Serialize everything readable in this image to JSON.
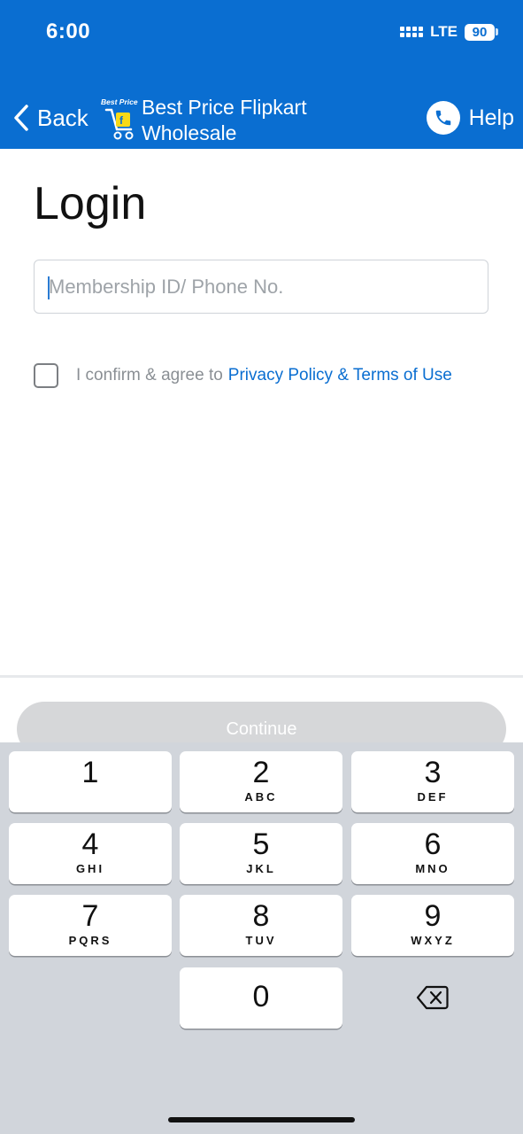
{
  "status_bar": {
    "time": "6:00",
    "network": "LTE",
    "battery": "90"
  },
  "nav": {
    "back_label": "Back",
    "logo_text": "Best Price",
    "title": "Best Price Flipkart Wholesale",
    "help_label": "Help"
  },
  "login": {
    "title": "Login",
    "input_placeholder": "Membership ID/ Phone No.",
    "input_value": "",
    "agree_text": "I confirm & agree to",
    "agree_link": "Privacy Policy & Terms of Use",
    "agree_checked": false,
    "continue_label": "Continue"
  },
  "keyboard": {
    "keys": [
      {
        "num": "1",
        "letters": ""
      },
      {
        "num": "2",
        "letters": "ABC"
      },
      {
        "num": "3",
        "letters": "DEF"
      },
      {
        "num": "4",
        "letters": "GHI"
      },
      {
        "num": "5",
        "letters": "JKL"
      },
      {
        "num": "6",
        "letters": "MNO"
      },
      {
        "num": "7",
        "letters": "PQRS"
      },
      {
        "num": "8",
        "letters": "TUV"
      },
      {
        "num": "9",
        "letters": "WXYZ"
      },
      {
        "num": "0",
        "letters": ""
      }
    ],
    "delete_icon": "backspace-icon"
  },
  "colors": {
    "brand_blue": "#0A6ED1",
    "link_blue": "#0A6ED1",
    "keyboard_bg": "#D1D5DB"
  }
}
